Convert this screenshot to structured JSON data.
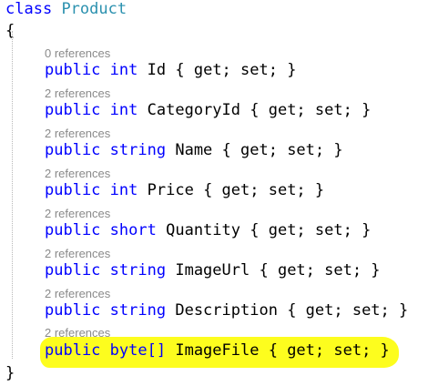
{
  "editor": {
    "class_line": {
      "keyword": "class",
      "name": "Product"
    },
    "open_brace": "{",
    "close_brace": "}",
    "properties": [
      {
        "refs": "0 references",
        "modifier": "public",
        "type": "int",
        "name": "Id",
        "accessors": "{ get; set; }"
      },
      {
        "refs": "2 references",
        "modifier": "public",
        "type": "int",
        "name": "CategoryId",
        "accessors": "{ get; set; }"
      },
      {
        "refs": "2 references",
        "modifier": "public",
        "type": "string",
        "name": "Name",
        "accessors": "{ get; set; }"
      },
      {
        "refs": "2 references",
        "modifier": "public",
        "type": "int",
        "name": "Price",
        "accessors": "{ get; set; }"
      },
      {
        "refs": "2 references",
        "modifier": "public",
        "type": "short",
        "name": "Quantity",
        "accessors": "{ get; set; }"
      },
      {
        "refs": "2 references",
        "modifier": "public",
        "type": "string",
        "name": "ImageUrl",
        "accessors": "{ get; set; }"
      },
      {
        "refs": "2 references",
        "modifier": "public",
        "type": "string",
        "name": "Description",
        "accessors": "{ get; set; }"
      },
      {
        "refs": "2 references",
        "modifier": "public",
        "type": "byte[]",
        "name": "ImageFile",
        "accessors": "{ get; set; }"
      }
    ],
    "colors": {
      "keyword": "#0000ff",
      "class_name": "#2b91af",
      "plain": "#000000",
      "codelens": "#8a8a8a",
      "highlight": "#fdfd1e"
    }
  }
}
